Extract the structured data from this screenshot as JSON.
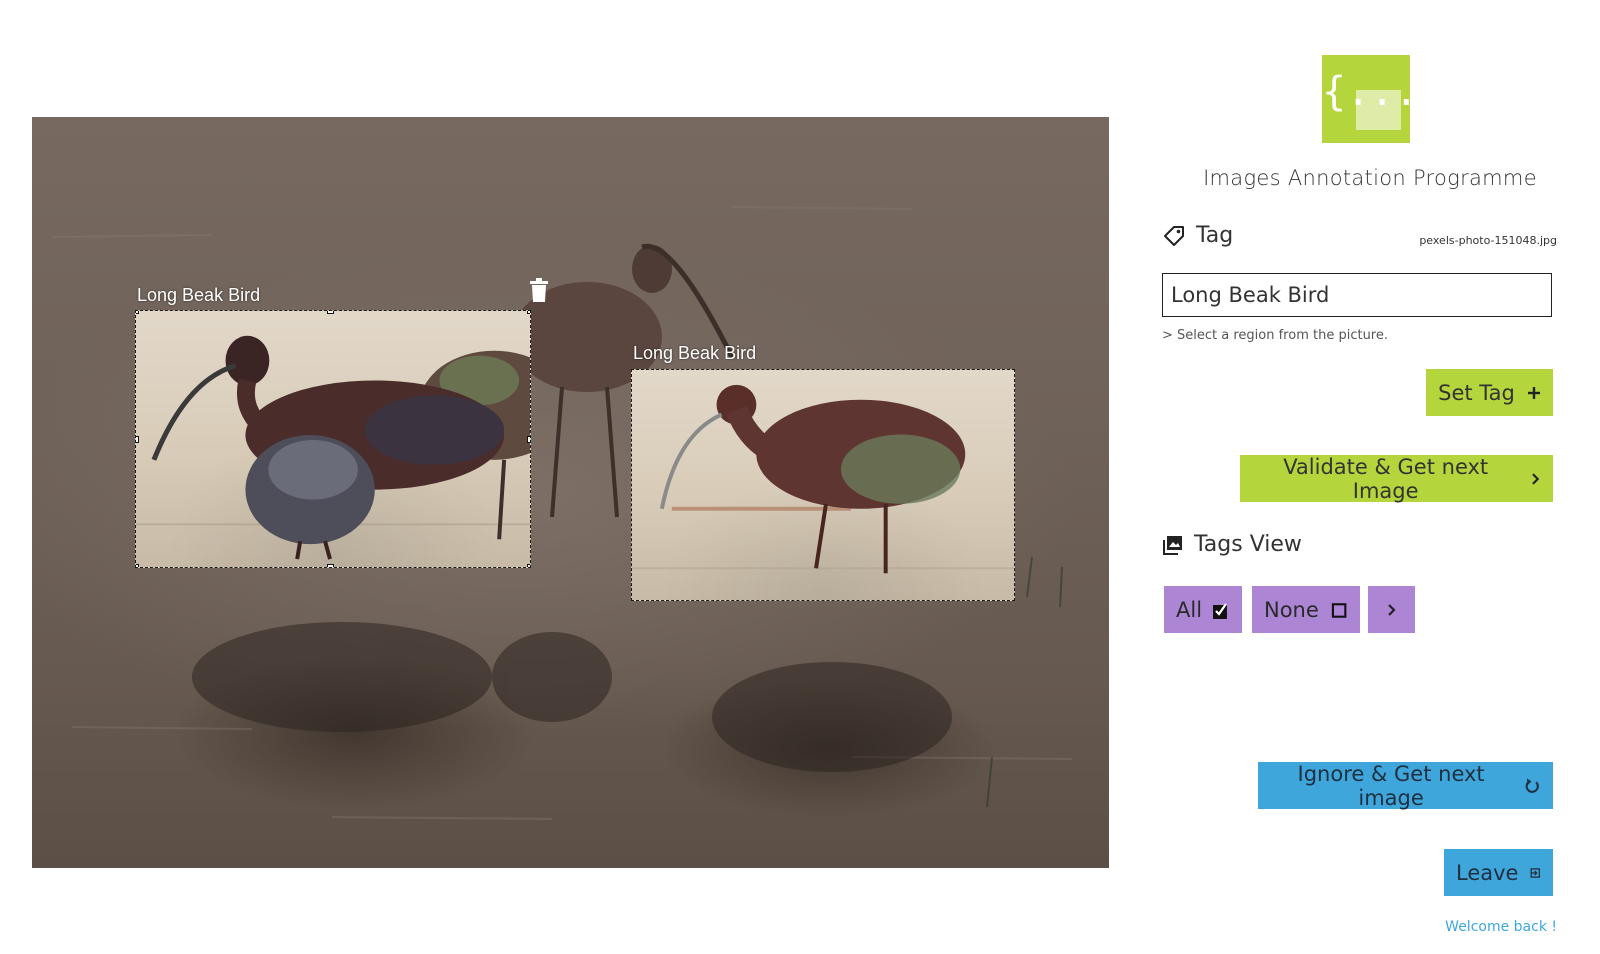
{
  "app": {
    "title": "Images Annotation Programme",
    "logo_glyph": "{...}"
  },
  "canvas": {
    "regions": [
      {
        "label": "Long Beak Bird"
      },
      {
        "label": "Long Beak Bird"
      }
    ]
  },
  "tag_section": {
    "heading": "Tag",
    "filename": "pexels-photo-151048.jpg",
    "input_value": "Long Beak Bird",
    "hint": "> Select a region from the picture.",
    "set_tag_label": "Set Tag"
  },
  "validate_label": "Validate & Get next Image",
  "tags_view": {
    "heading": "Tags View",
    "all_label": "All",
    "none_label": "None"
  },
  "ignore_label": "Ignore & Get next image",
  "leave_label": "Leave",
  "welcome_text": "Welcome back !",
  "colors": {
    "green": "#b5d53c",
    "blue": "#3fa6dc",
    "purple": "#ad85d5"
  },
  "icons": {
    "tag": "tag-icon",
    "plus": "plus-icon",
    "chevron": "chevron-right-icon",
    "image": "image-icon",
    "checked": "checked-box-icon",
    "empty": "empty-box-icon",
    "refresh": "refresh-icon",
    "exit": "exit-icon",
    "trash": "trash-icon"
  }
}
